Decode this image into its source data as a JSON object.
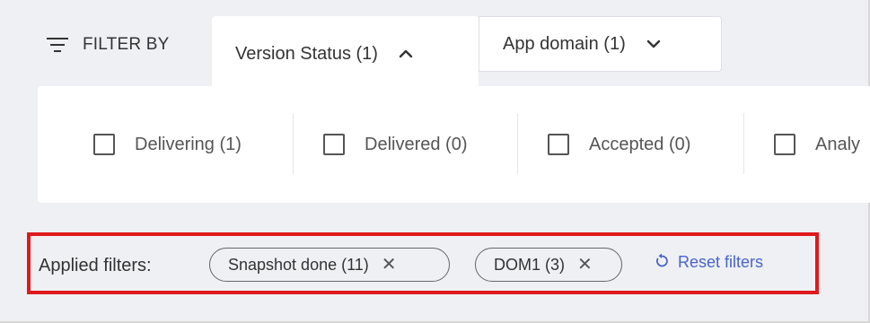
{
  "filter_bar": {
    "label": "FILTER BY",
    "tabs": [
      {
        "label": "Version Status (1)",
        "expanded": true
      },
      {
        "label": "App domain (1)",
        "expanded": false
      }
    ]
  },
  "status_options": [
    {
      "label": "Delivering (1)",
      "checked": false
    },
    {
      "label": "Delivered (0)",
      "checked": false
    },
    {
      "label": "Accepted (0)",
      "checked": false
    },
    {
      "label": "Analy",
      "checked": false
    }
  ],
  "applied_filters": {
    "label": "Applied filters:",
    "chips": [
      {
        "label": "Snapshot done (11)"
      },
      {
        "label": "DOM1 (3)"
      }
    ],
    "reset_label": "Reset filters"
  },
  "colors": {
    "accent": "#4a63c8",
    "highlight_border": "#e0191c",
    "background": "#eef0f4"
  },
  "icons": [
    "filter-icon",
    "chevron-up-icon",
    "chevron-down-icon",
    "close-icon",
    "reset-icon"
  ]
}
